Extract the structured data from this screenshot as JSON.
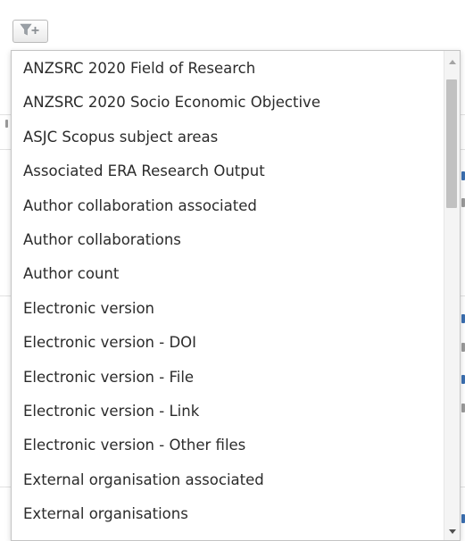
{
  "filter_button": {
    "icon": "filter-plus-icon"
  },
  "dropdown": {
    "options": [
      "ANZSRC 2020 Field of Research",
      "ANZSRC 2020 Socio Economic Objective",
      "ASJC Scopus subject areas",
      "Associated ERA Research Output",
      "Author collaboration associated",
      "Author collaborations",
      "Author count",
      "Electronic version",
      "Electronic version - DOI",
      "Electronic version - File",
      "Electronic version - Link",
      "Electronic version - Other files",
      "External organisation associated",
      "External organisations"
    ],
    "scroll_position": 0.0
  },
  "colors": {
    "text": "#2b2b2b",
    "border": "#c4c4c4",
    "link_fragment": "#3b6fb0",
    "scroll_thumb": "#c1c1c1"
  }
}
